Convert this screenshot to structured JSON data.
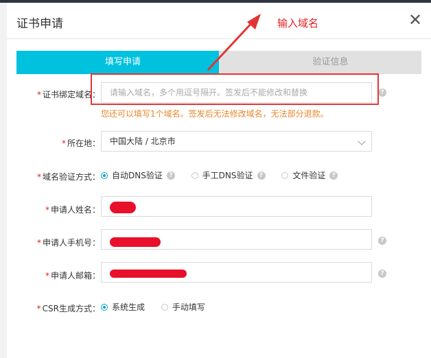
{
  "dialog": {
    "title": "证书申请",
    "close_glyph": "✕"
  },
  "annotation": {
    "text": "输入域名",
    "color": "#e02020"
  },
  "steps": [
    {
      "label": "填写申请",
      "active": true
    },
    {
      "label": "验证信息",
      "active": false
    }
  ],
  "form": {
    "domain": {
      "label": "证书绑定域名：",
      "placeholder": "请输入域名，多个用逗号隔开。签发后不能修改和替换",
      "hint": "您还可以填写1个域名。签发后无法修改域名，无法部分退款。"
    },
    "location": {
      "label": "所在地：",
      "value": "中国大陆 / 北京市"
    },
    "verify_method": {
      "label": "域名验证方式：",
      "options": [
        "自动DNS验证",
        "手工DNS验证",
        "文件验证"
      ],
      "selected": "自动DNS验证"
    },
    "applicant_name": {
      "label": "申请人姓名："
    },
    "applicant_phone": {
      "label": "申请人手机号："
    },
    "applicant_email": {
      "label": "申请人邮箱："
    },
    "csr": {
      "label": "CSR生成方式：",
      "options": [
        "系统生成",
        "手动填写"
      ],
      "selected": "系统生成"
    }
  },
  "colors": {
    "accent": "#00c1de",
    "required": "#e02020",
    "hint": "#e8862a"
  }
}
